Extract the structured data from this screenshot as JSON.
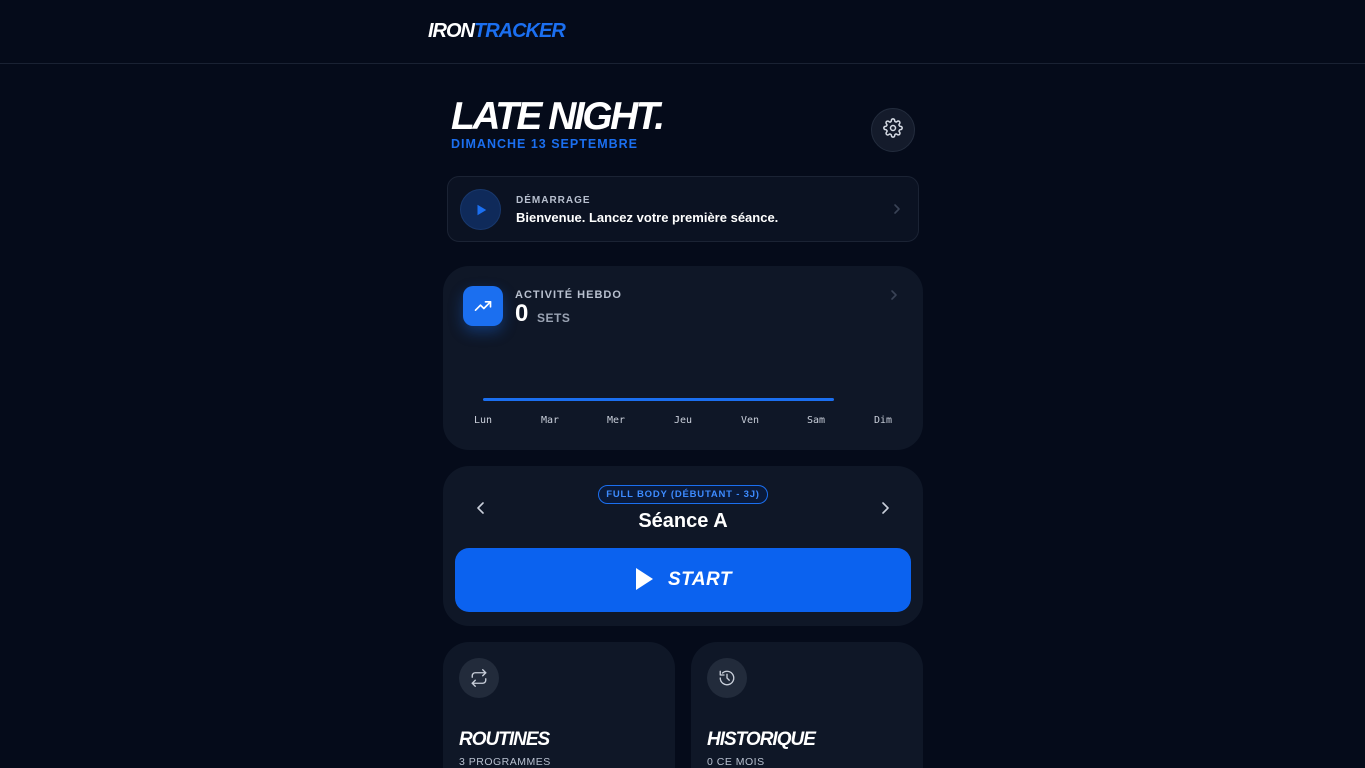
{
  "app": {
    "logo_part1": "IRON",
    "logo_part2": "TRACKER"
  },
  "header": {
    "greeting": "LATE NIGHT.",
    "date": "DIMANCHE 13 SEPTEMBRE"
  },
  "welcome": {
    "kicker": "DÉMARRAGE",
    "message": "Bienvenue. Lancez votre première séance."
  },
  "activity": {
    "kicker": "ACTIVITÉ HEBDO",
    "count": "0",
    "unit": "SETS",
    "days": [
      "Lun",
      "Mar",
      "Mer",
      "Jeu",
      "Ven",
      "Sam",
      "Dim"
    ]
  },
  "session": {
    "program": "FULL BODY (DÉBUTANT - 3J)",
    "name": "Séance A",
    "start_label": "START"
  },
  "tiles": {
    "routines": {
      "title": "ROUTINES",
      "subtitle": "3 PROGRAMMES"
    },
    "history": {
      "title": "HISTORIQUE",
      "subtitle": "0 CE MOIS"
    }
  },
  "colors": {
    "accent": "#1b6ff0",
    "background": "#050b1a",
    "card": "#0f1727"
  },
  "icons": [
    "gear-icon",
    "play-icon",
    "chevron-right-icon",
    "trending-up-icon",
    "chevron-left-icon",
    "repeat-icon",
    "history-icon"
  ]
}
